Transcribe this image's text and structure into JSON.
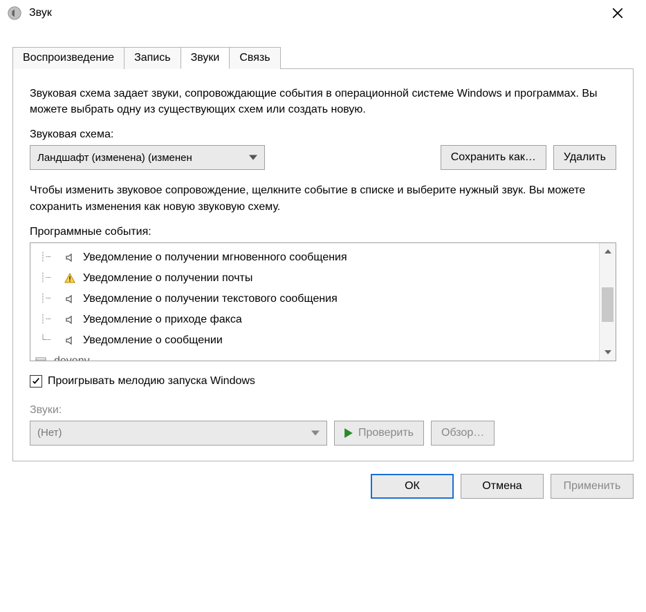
{
  "window": {
    "title": "Звук"
  },
  "tabs": {
    "playback": "Воспроизведение",
    "recording": "Запись",
    "sounds": "Звуки",
    "comm": "Связь"
  },
  "description": "Звуковая схема задает звуки, сопровождающие события в операционной системе Windows и программах. Вы можете выбрать одну из существующих схем или создать новую.",
  "scheme_label": "Звуковая схема:",
  "scheme_selected": "Ландшафт (изменена) (изменен",
  "buttons": {
    "save_as": "Сохранить как…",
    "delete": "Удалить",
    "test": "Проверить",
    "browse": "Обзор…",
    "ok": "ОК",
    "cancel": "Отмена",
    "apply": "Применить"
  },
  "events_desc": "Чтобы изменить звуковое сопровождение, щелкните событие в списке и выберите нужный звук. Вы можете сохранить изменения как новую звуковую схему.",
  "events_label": "Программные события:",
  "events": [
    {
      "icon": "speaker",
      "text": "Уведомление о получении мгновенного сообщения"
    },
    {
      "icon": "warning",
      "text": "Уведомление о получении почты"
    },
    {
      "icon": "speaker",
      "text": "Уведомление о получении текстового сообщения"
    },
    {
      "icon": "speaker",
      "text": "Уведомление о приходе факса"
    },
    {
      "icon": "speaker",
      "text": "Уведомление о сообщении"
    },
    {
      "icon": "app",
      "text": "devenv"
    }
  ],
  "play_startup": "Проигрывать мелодию запуска Windows",
  "sounds_label": "Звуки:",
  "sound_selected": "(Нет)"
}
